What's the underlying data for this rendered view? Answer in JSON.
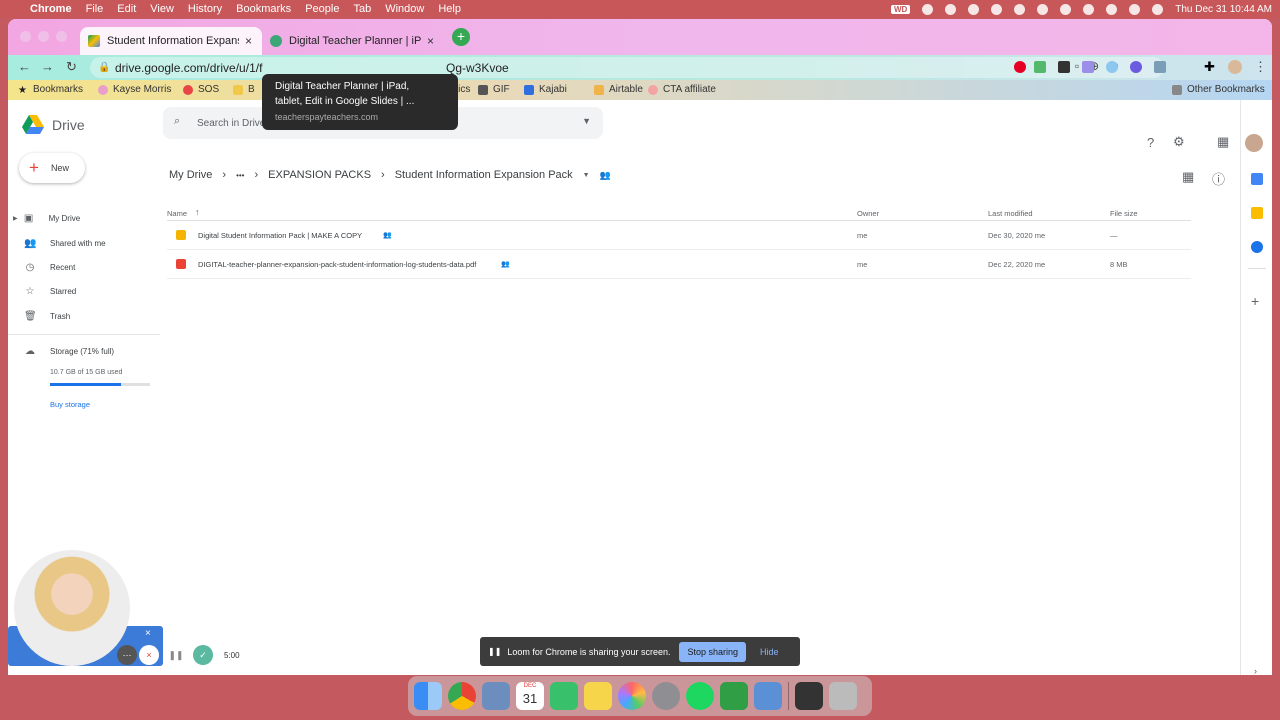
{
  "menubar": {
    "apple": "",
    "app": "Chrome",
    "items": [
      "File",
      "Edit",
      "View",
      "History",
      "Bookmarks",
      "People",
      "Tab",
      "Window",
      "Help"
    ],
    "clock": "Thu Dec 31  10:44 AM",
    "wd": "WD"
  },
  "tabs": [
    {
      "title": "Student Information Expansion",
      "active": true
    },
    {
      "title": "Digital Teacher Planner | iPad, t",
      "active": false
    }
  ],
  "toolbar": {
    "url": "drive.google.com/drive/u/1/f",
    "url_tail": "Qg-w3Kvoe"
  },
  "bookmarks": [
    "Bookmarks",
    "Kayse Morris",
    "SOS",
    "B",
    "rtics",
    "GIF",
    "Kajabi",
    "Airtable",
    "CTA affiliate"
  ],
  "other_bookmarks": "Other Bookmarks",
  "tooltip": {
    "line1": "Digital Teacher Planner | iPad,",
    "line2": "tablet, Edit in Google Slides | ...",
    "url": "teacherspayteachers.com"
  },
  "drive": {
    "logo": "Drive",
    "search_placeholder": "Search in Drive",
    "new": "New",
    "nav": [
      "My Drive",
      "Shared with me",
      "Recent",
      "Starred",
      "Trash"
    ],
    "storage": "Storage (71% full)",
    "storage_used": "10.7 GB of 15 GB used",
    "storage_fraction": 0.71,
    "buy": "Buy storage",
    "breadcrumb": [
      "My Drive",
      "•••",
      "EXPANSION PACKS",
      "Student Information Expansion Pack"
    ],
    "columns": {
      "name": "Name",
      "owner": "Owner",
      "modified": "Last modified",
      "size": "File size"
    },
    "rows": [
      {
        "name": "Digital Student Information Pack | MAKE A COPY",
        "owner": "me",
        "modified": "Dec 30, 2020 me",
        "size": "—",
        "type": "slides"
      },
      {
        "name": "DIGITAL-teacher-planner-expansion-pack-student-information-log-students-data.pdf",
        "owner": "me",
        "modified": "Dec 22, 2020 me",
        "size": "8 MB",
        "type": "pdf"
      }
    ]
  },
  "loom": {
    "message": "Loom for Chrome is sharing your screen.",
    "stop": "Stop sharing",
    "hide": "Hide",
    "timer": "5:00"
  },
  "dock": {
    "calendar_day": "31",
    "calendar_month": "DEC"
  },
  "colors": {
    "menubar": "#c8575a",
    "drive_blue": "#1a73e8",
    "loom_blue": "#3d7bd9"
  }
}
